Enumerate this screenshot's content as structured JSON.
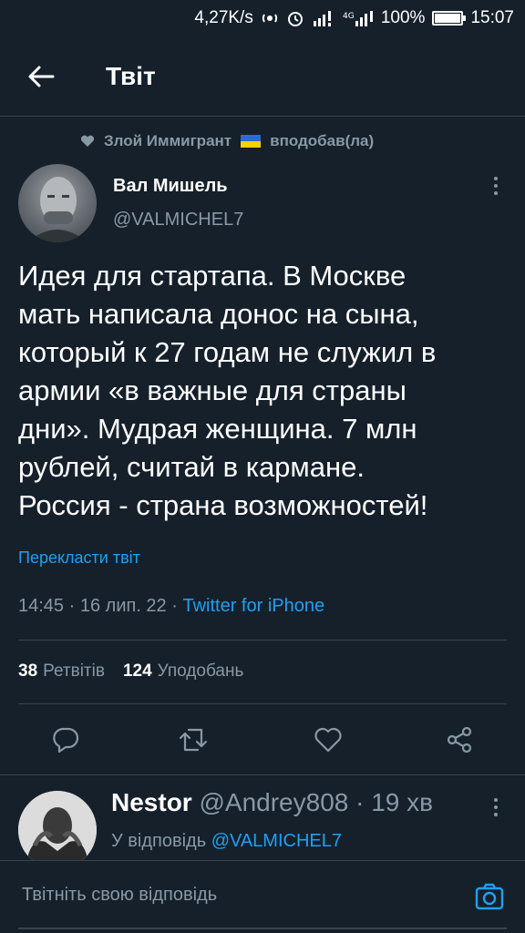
{
  "status_bar": {
    "net_speed": "4,27K/s",
    "battery": "100%",
    "battery_level": 1.0,
    "time": "15:07"
  },
  "header": {
    "title": "Твіт"
  },
  "liked_by": {
    "user": "Злой Иммигрант",
    "action": "вподобав(ла)"
  },
  "tweet": {
    "author_name": "Вал Мишель",
    "author_handle": "@VALMICHEL7",
    "text": "Идея для стартапа. В Москве\nмать написала донос на сына,\nкоторый к 27 годам не служил в\nармии «в важные для страны\nдни». Мудрая женщина. 7 млн\nрублей, считай в кармане.\nРоссия - страна возможностей!",
    "translate_label": "Перекласти твіт",
    "time": "14:45",
    "date": "16 лип. 22",
    "source": "Twitter for iPhone",
    "retweets_count": "38",
    "retweets_label": "Ретвітів",
    "likes_count": "124",
    "likes_label": "Уподобань"
  },
  "reply": {
    "name": "Nestor",
    "handle": "@Andrey808",
    "age": "19 хв",
    "reply_prefix": "У відповідь",
    "reply_mention": "@VALMICHEL7"
  },
  "compose": {
    "placeholder": "Твітніть свою відповідь"
  },
  "colors": {
    "background": "#15202b",
    "accent": "#1da1f2",
    "muted": "#8899a6",
    "divider": "#38444d"
  },
  "icons": [
    "back-arrow-icon",
    "heart-icon",
    "more-vertical-icon",
    "reply-icon",
    "retweet-icon",
    "like-icon",
    "share-icon",
    "camera-icon"
  ]
}
